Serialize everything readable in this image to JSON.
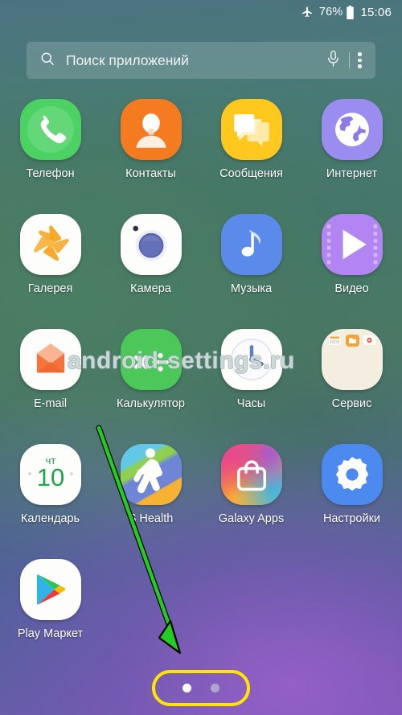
{
  "status_bar": {
    "airplane_icon": "airplane-icon",
    "battery_percent": "76%",
    "battery_icon": "battery-icon",
    "clock": "15:06"
  },
  "search": {
    "search_icon": "search-icon",
    "placeholder": "Поиск приложений",
    "mic_icon": "microphone-icon",
    "more_icon": "more-options-icon"
  },
  "app_grid": {
    "rows": [
      [
        {
          "label": "Телефон",
          "icon": "phone-icon"
        },
        {
          "label": "Контакты",
          "icon": "contacts-icon"
        },
        {
          "label": "Сообщения",
          "icon": "messages-icon"
        },
        {
          "label": "Интернет",
          "icon": "internet-icon"
        }
      ],
      [
        {
          "label": "Галерея",
          "icon": "gallery-icon"
        },
        {
          "label": "Камера",
          "icon": "camera-icon"
        },
        {
          "label": "Музыка",
          "icon": "music-icon"
        },
        {
          "label": "Видео",
          "icon": "video-icon"
        }
      ],
      [
        {
          "label": "E-mail",
          "icon": "email-icon"
        },
        {
          "label": "Калькулятор",
          "icon": "calculator-icon"
        },
        {
          "label": "Часы",
          "icon": "clock-icon"
        },
        {
          "label": "Сервис",
          "icon": "service-folder-icon"
        }
      ],
      [
        {
          "label": "Календарь",
          "icon": "calendar-icon",
          "day_name": "чт",
          "day_number": "10"
        },
        {
          "label": "S Health",
          "icon": "s-health-icon"
        },
        {
          "label": "Galaxy Apps",
          "icon": "galaxy-apps-icon"
        },
        {
          "label": "Настройки",
          "icon": "settings-icon"
        }
      ],
      [
        {
          "label": "Play Маркет",
          "icon": "play-store-icon"
        },
        {
          "label": "",
          "icon": ""
        },
        {
          "label": "",
          "icon": ""
        },
        {
          "label": "",
          "icon": ""
        }
      ]
    ]
  },
  "watermark": {
    "text": "android-settings.ru"
  },
  "annotations": {
    "arrow_color": "#22cc22",
    "highlight_color": "#ffe500"
  },
  "page_indicator": {
    "pages": 2,
    "current_page": 1
  }
}
